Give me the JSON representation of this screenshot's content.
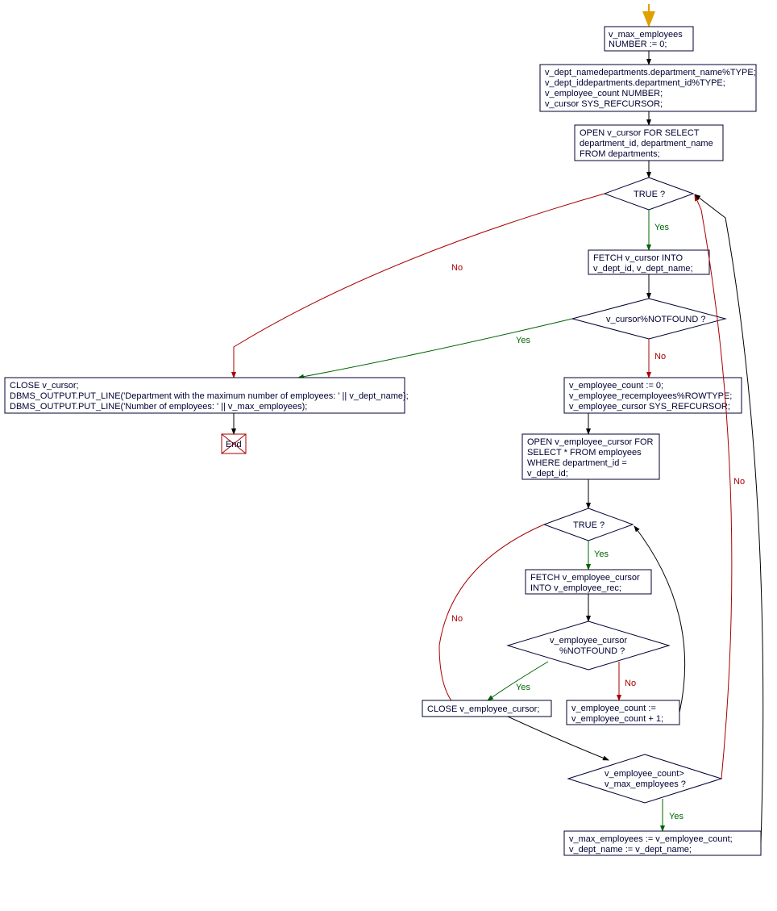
{
  "chart_data": {
    "type": "flowchart",
    "nodes": {
      "n1": {
        "kind": "process",
        "text": [
          "v_max_employees",
          "NUMBER := 0;"
        ]
      },
      "n2": {
        "kind": "process",
        "text": [
          "v_dept_namedepartments.department_name%TYPE;",
          "v_dept_iddepartments.department_id%TYPE;",
          "v_employee_count NUMBER;",
          "v_cursor SYS_REFCURSOR;"
        ]
      },
      "n3": {
        "kind": "process",
        "text": [
          "OPEN v_cursor FOR SELECT",
          "department_id, department_name",
          "FROM departments;"
        ]
      },
      "d1": {
        "kind": "decision",
        "text": [
          "TRUE ?"
        ]
      },
      "n4": {
        "kind": "process",
        "text": [
          "FETCH v_cursor INTO",
          "v_dept_id, v_dept_name;"
        ]
      },
      "d2": {
        "kind": "decision",
        "text": [
          "v_cursor%NOTFOUND ?"
        ]
      },
      "n5": {
        "kind": "process",
        "text": [
          "v_employee_count := 0;",
          "v_employee_recemployees%ROWTYPE;",
          "v_employee_cursor SYS_REFCURSOR;"
        ]
      },
      "n6": {
        "kind": "process",
        "text": [
          "OPEN v_employee_cursor FOR",
          "SELECT * FROM employees",
          "WHERE department_id =",
          "v_dept_id;"
        ]
      },
      "d3": {
        "kind": "decision",
        "text": [
          "TRUE ?"
        ]
      },
      "n7": {
        "kind": "process",
        "text": [
          "FETCH v_employee_cursor",
          "INTO v_employee_rec;"
        ]
      },
      "d4": {
        "kind": "decision",
        "text": [
          "v_employee_cursor",
          "%NOTFOUND ?"
        ]
      },
      "n8": {
        "kind": "process",
        "text": [
          "v_employee_count :=",
          "v_employee_count + 1;"
        ]
      },
      "n9": {
        "kind": "process",
        "text": [
          "CLOSE v_employee_cursor;"
        ]
      },
      "d5": {
        "kind": "decision",
        "text": [
          "v_employee_count>",
          "v_max_employees ?"
        ]
      },
      "n10": {
        "kind": "process",
        "text": [
          "v_max_employees := v_employee_count;",
          "v_dept_name := v_dept_name;"
        ]
      },
      "n11": {
        "kind": "process",
        "text": [
          "CLOSE v_cursor;",
          "DBMS_OUTPUT.PUT_LINE('Department with the maximum number of employees: ' || v_dept_name);",
          "DBMS_OUTPUT.PUT_LINE('Number of employees: ' || v_max_employees);"
        ]
      },
      "end": {
        "kind": "terminator",
        "text": [
          "End"
        ]
      }
    },
    "edges": [
      {
        "from": "start",
        "to": "n1"
      },
      {
        "from": "n1",
        "to": "n2"
      },
      {
        "from": "n2",
        "to": "n3"
      },
      {
        "from": "n3",
        "to": "d1"
      },
      {
        "from": "d1",
        "to": "n4",
        "label": "Yes"
      },
      {
        "from": "d1",
        "to": "n11",
        "label": "No"
      },
      {
        "from": "n4",
        "to": "d2"
      },
      {
        "from": "d2",
        "to": "n11",
        "label": "Yes"
      },
      {
        "from": "d2",
        "to": "n5",
        "label": "No"
      },
      {
        "from": "n5",
        "to": "n6"
      },
      {
        "from": "n6",
        "to": "d3"
      },
      {
        "from": "d3",
        "to": "n7",
        "label": "Yes"
      },
      {
        "from": "d3",
        "to": "n9",
        "label": "No"
      },
      {
        "from": "n7",
        "to": "d4"
      },
      {
        "from": "d4",
        "to": "n9",
        "label": "Yes"
      },
      {
        "from": "d4",
        "to": "n8",
        "label": "No"
      },
      {
        "from": "n8",
        "to": "d3"
      },
      {
        "from": "n9",
        "to": "d5"
      },
      {
        "from": "d5",
        "to": "n10",
        "label": "Yes"
      },
      {
        "from": "d5",
        "to": "d1",
        "label": "No"
      },
      {
        "from": "n10",
        "to": "d1"
      },
      {
        "from": "n11",
        "to": "end"
      }
    ]
  },
  "labels": {
    "yes": "Yes",
    "no": "No"
  }
}
